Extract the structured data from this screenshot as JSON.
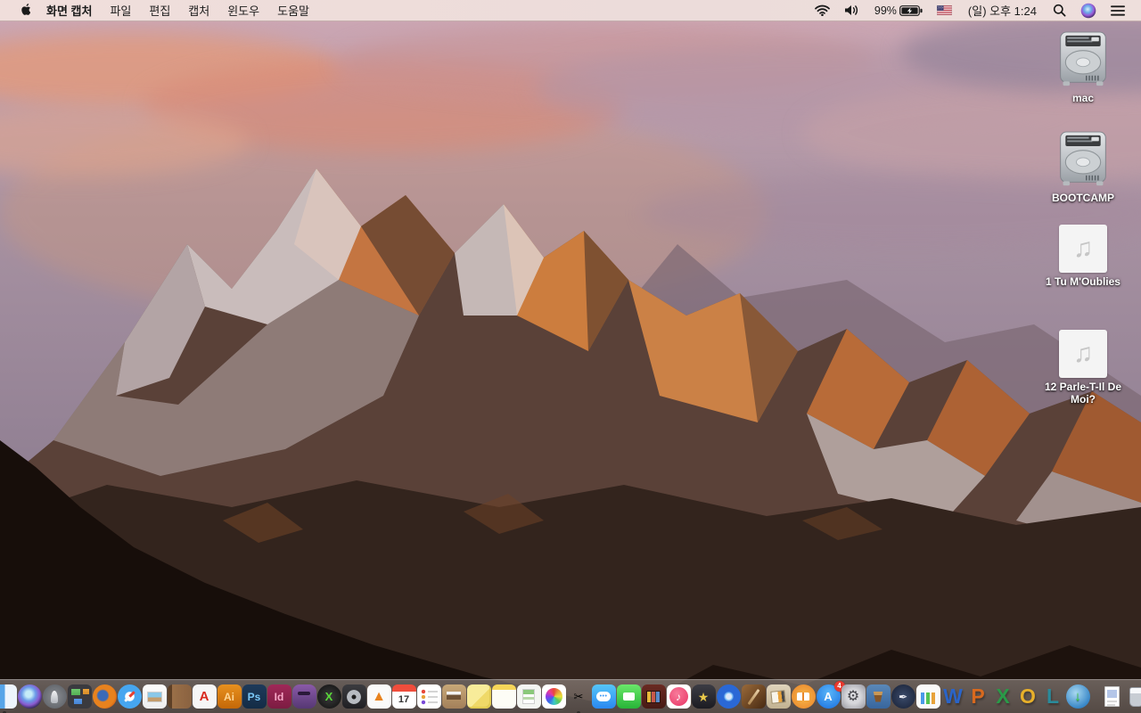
{
  "menu_bar": {
    "app_name": "화면 캡처",
    "menus": [
      "파일",
      "편집",
      "캡처",
      "윈도우",
      "도움말"
    ],
    "status": {
      "battery_percent": "99%",
      "battery_state": "charging",
      "input_source": "us-flag",
      "clock": "(일) 오후 1:24"
    }
  },
  "desktop": {
    "icons": [
      {
        "label": "mac",
        "type": "hard-drive"
      },
      {
        "label": "BOOTCAMP",
        "type": "hard-drive"
      },
      {
        "label": "1 Tu M'Oublies",
        "type": "audio-file"
      },
      {
        "label": "12 Parle-T-Il De Moi?",
        "type": "audio-file"
      }
    ],
    "audio_note_glyph": "♫"
  },
  "dock": {
    "items": [
      {
        "name": "finder",
        "glyph": "",
        "running": true
      },
      {
        "name": "siri",
        "glyph": ""
      },
      {
        "name": "launchpad",
        "glyph": ""
      },
      {
        "name": "mission-control",
        "glyph": ""
      },
      {
        "name": "firefox",
        "glyph": ""
      },
      {
        "name": "safari",
        "glyph": ""
      },
      {
        "name": "preview",
        "glyph": ""
      },
      {
        "name": "contacts",
        "glyph": ""
      },
      {
        "name": "acrobat-reader",
        "glyph": "A"
      },
      {
        "name": "illustrator",
        "glyph": "Ai"
      },
      {
        "name": "photoshop",
        "glyph": "Ps"
      },
      {
        "name": "indesign",
        "glyph": "Id"
      },
      {
        "name": "toast",
        "glyph": ""
      },
      {
        "name": "green-x-app",
        "glyph": "X"
      },
      {
        "name": "fan-utility",
        "glyph": ""
      },
      {
        "name": "vlc",
        "glyph": "▲"
      },
      {
        "name": "calendar",
        "glyph": "17"
      },
      {
        "name": "reminders",
        "glyph": ""
      },
      {
        "name": "printer-utility",
        "glyph": ""
      },
      {
        "name": "stickies",
        "glyph": ""
      },
      {
        "name": "notes",
        "glyph": ""
      },
      {
        "name": "documents-app",
        "glyph": ""
      },
      {
        "name": "photos",
        "glyph": ""
      },
      {
        "name": "grab-screen-capture",
        "glyph": "✂",
        "running": true
      },
      {
        "name": "messages",
        "glyph": "•••"
      },
      {
        "name": "facetime",
        "glyph": ""
      },
      {
        "name": "photo-booth",
        "glyph": ""
      },
      {
        "name": "itunes",
        "glyph": "♪"
      },
      {
        "name": "imovie",
        "glyph": "★"
      },
      {
        "name": "dvd-player",
        "glyph": ""
      },
      {
        "name": "garageband",
        "glyph": ""
      },
      {
        "name": "collage-app",
        "glyph": ""
      },
      {
        "name": "ibooks",
        "glyph": ""
      },
      {
        "name": "app-store",
        "glyph": "A",
        "badge": "4"
      },
      {
        "name": "system-preferences",
        "glyph": "⚙"
      },
      {
        "name": "keynote",
        "glyph": ""
      },
      {
        "name": "pages",
        "glyph": "✒"
      },
      {
        "name": "numbers",
        "glyph": ""
      },
      {
        "name": "word",
        "glyph": "W"
      },
      {
        "name": "powerpoint",
        "glyph": "P"
      },
      {
        "name": "excel",
        "glyph": "X"
      },
      {
        "name": "outlook",
        "glyph": "O"
      },
      {
        "name": "lync",
        "glyph": "L"
      },
      {
        "name": "download-globe",
        "glyph": "↓"
      },
      {
        "name": "divider",
        "divider": true
      },
      {
        "name": "document-file",
        "glyph": ""
      },
      {
        "name": "trash",
        "glyph": ""
      }
    ]
  },
  "colors": {
    "menubar_bg": "#eedcd9",
    "dock_bg": "rgba(140,130,124,0.55)",
    "badge_red": "#e8392e",
    "sky_pink": "#cba6b3",
    "sunlit_orange": "#d8843f",
    "rock_dark": "#170e0a"
  }
}
